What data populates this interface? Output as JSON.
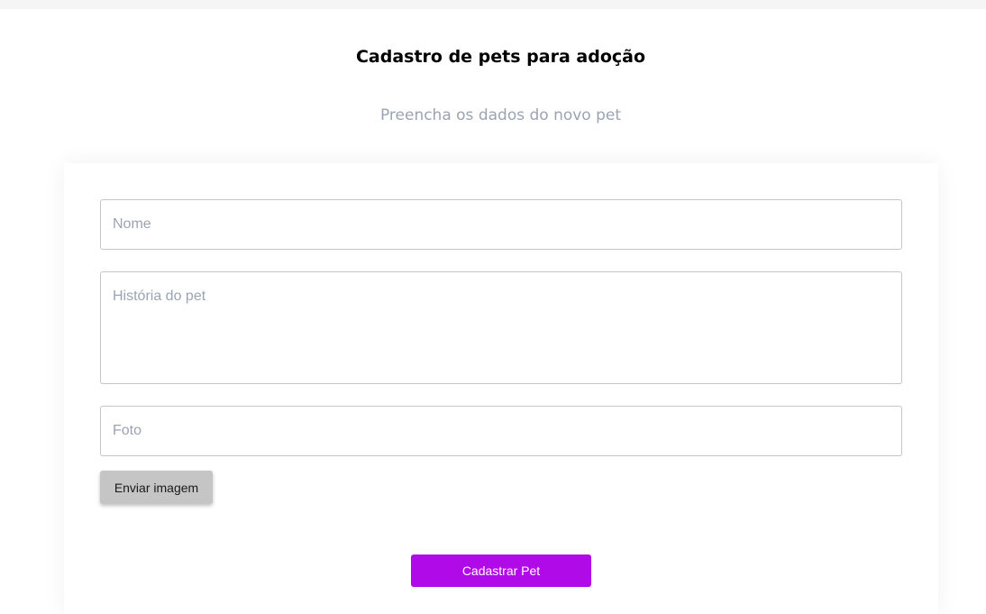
{
  "header": {
    "title": "Cadastro de pets para adoção",
    "subtitle": "Preencha os dados do novo pet"
  },
  "form": {
    "name_placeholder": "Nome",
    "name_value": "",
    "story_placeholder": "História do pet",
    "story_value": "",
    "photo_placeholder": "Foto",
    "photo_value": "",
    "upload_label": "Enviar imagem",
    "submit_label": "Cadastrar Pet"
  },
  "colors": {
    "accent": "#b10ae8",
    "upload_button": "#c5c5c5",
    "placeholder": "#9aa4b2"
  }
}
